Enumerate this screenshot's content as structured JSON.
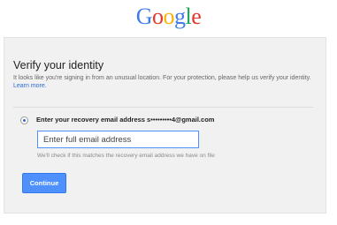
{
  "logo": {
    "letters": [
      {
        "char": "G",
        "color": "#3e7ce8"
      },
      {
        "char": "o",
        "color": "#e2372d"
      },
      {
        "char": "o",
        "color": "#f4b400"
      },
      {
        "char": "g",
        "color": "#3e7ce8"
      },
      {
        "char": "l",
        "color": "#1da353"
      },
      {
        "char": "e",
        "color": "#e2372d"
      }
    ]
  },
  "card": {
    "title": "Verify your identity",
    "description": "It looks like you're signing in from an unusual location. For your protection, please help us verify your identity.",
    "learn_more": "Learn more.",
    "option_label": "Enter your recovery email address s•••••••••4@gmail.com",
    "option_selected": true,
    "email_input": {
      "value": "",
      "placeholder": "Enter full email address"
    },
    "hint": "We'll check if this matches the recovery email address we have on file",
    "continue_label": "Continue"
  },
  "colors": {
    "accent": "#4d90fe",
    "link": "#2a6bd6",
    "card_bg": "#f1f1f1"
  }
}
